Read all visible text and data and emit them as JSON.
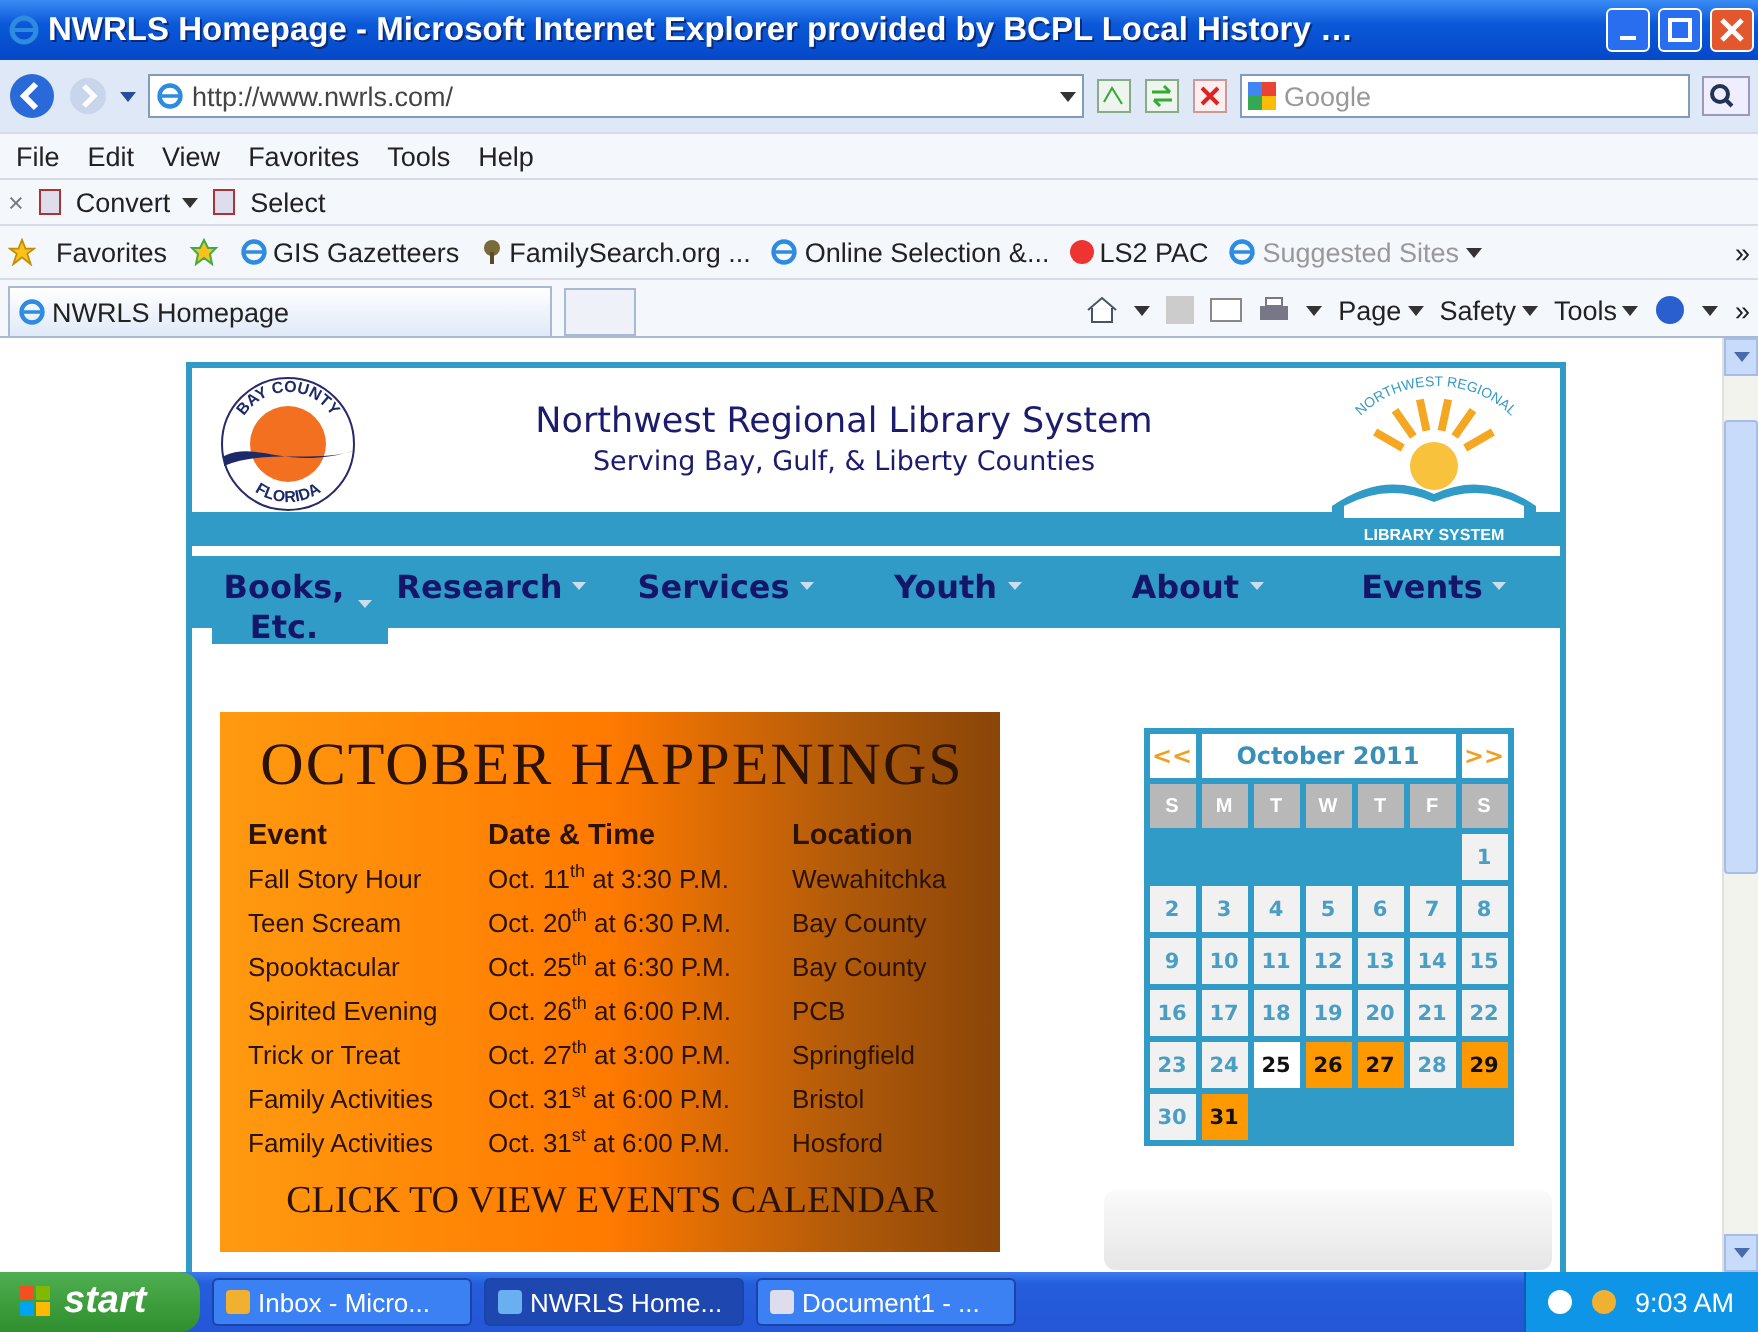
{
  "window": {
    "title": "NWRLS Homepage - Microsoft Internet Explorer provided by BCPL Local History …"
  },
  "address_bar": {
    "value": "http://www.nwrls.com/"
  },
  "search": {
    "placeholder": "Google"
  },
  "menu": [
    "File",
    "Edit",
    "View",
    "Favorites",
    "Tools",
    "Help"
  ],
  "addon_bar": {
    "close": "×",
    "items": [
      "Convert",
      "Select"
    ]
  },
  "favorites_bar": {
    "label": "Favorites",
    "items": [
      "GIS Gazetteers",
      "FamilySearch.org ...",
      "Online Selection &...",
      "LS2 PAC",
      "Suggested Sites"
    ],
    "more": "»"
  },
  "tabs": [
    {
      "label": "NWRLS Homepage",
      "selected": true
    }
  ],
  "command_bar": {
    "items": [
      "Page",
      "Safety",
      "Tools"
    ],
    "more": "»"
  },
  "site": {
    "title": "Northwest Regional Library System",
    "subtitle": "Serving Bay, Gulf, & Liberty Counties",
    "seal": {
      "top": "BAY COUNTY",
      "bottom": "FLORIDA"
    },
    "logo": {
      "arc": "NORTHWEST REGIONAL",
      "caption": "LIBRARY SYSTEM"
    },
    "nav": [
      {
        "label": "Books, Etc.",
        "selected": true
      },
      {
        "label": "Research",
        "selected": false
      },
      {
        "label": "Services",
        "selected": false
      },
      {
        "label": "Youth",
        "selected": false
      },
      {
        "label": "About",
        "selected": false
      },
      {
        "label": "Events",
        "selected": false
      }
    ]
  },
  "poster": {
    "title": "OCTOBER HAPPENINGS",
    "columns": [
      "Event",
      "Date & Time",
      "Location"
    ],
    "rows": [
      [
        "Fall Story Hour",
        "Oct. 11$^{th}$ at 3:30 P.M.",
        "Wewahitchka"
      ],
      [
        "Teen Scream",
        "Oct. 20$^{th}$ at 6:30 P.M.",
        "Bay County"
      ],
      [
        "Spooktacular",
        "Oct. 25$^{th}$ at 6:30 P.M.",
        "Bay County"
      ],
      [
        "Spirited Evening",
        "Oct. 26$^{th}$ at 6:00 P.M.",
        "PCB"
      ],
      [
        "Trick or Treat",
        "Oct. 27$^{th}$ at 3:00 P.M.",
        "Springfield"
      ],
      [
        "Family Activities",
        "Oct. 31$^{st}$ at 6:00 P.M.",
        "Bristol"
      ],
      [
        "Family Activities",
        "Oct. 31$^{st}$ at 6:00 P.M.",
        "Hosford"
      ]
    ],
    "link": "CLICK TO VIEW EVENTS CALENDAR"
  },
  "calendar": {
    "prev": "<<",
    "month": "October 2011",
    "next": ">>",
    "weekdays": [
      "S",
      "M",
      "T",
      "W",
      "T",
      "F",
      "S"
    ],
    "weeks": [
      [
        {
          "day": "1",
          "kind": "normal"
        }
      ],
      [
        {
          "day": "2",
          "kind": "normal"
        },
        {
          "day": "3",
          "kind": "normal"
        },
        {
          "day": "4",
          "kind": "normal"
        },
        {
          "day": "5",
          "kind": "normal"
        },
        {
          "day": "6",
          "kind": "normal"
        },
        {
          "day": "7",
          "kind": "normal"
        },
        {
          "day": "8",
          "kind": "normal"
        }
      ],
      [
        {
          "day": "9",
          "kind": "normal"
        },
        {
          "day": "10",
          "kind": "normal"
        },
        {
          "day": "11",
          "kind": "normal"
        },
        {
          "day": "12",
          "kind": "normal"
        },
        {
          "day": "13",
          "kind": "normal"
        },
        {
          "day": "14",
          "kind": "normal"
        },
        {
          "day": "15",
          "kind": "normal"
        }
      ],
      [
        {
          "day": "16",
          "kind": "normal"
        },
        {
          "day": "17",
          "kind": "normal"
        },
        {
          "day": "18",
          "kind": "normal"
        },
        {
          "day": "19",
          "kind": "normal"
        },
        {
          "day": "20",
          "kind": "normal"
        },
        {
          "day": "21",
          "kind": "normal"
        },
        {
          "day": "22",
          "kind": "normal"
        }
      ],
      [
        {
          "day": "23",
          "kind": "normal"
        },
        {
          "day": "24",
          "kind": "normal"
        },
        {
          "day": "25",
          "kind": "today"
        },
        {
          "day": "26",
          "kind": "event"
        },
        {
          "day": "27",
          "kind": "event"
        },
        {
          "day": "28",
          "kind": "normal"
        },
        {
          "day": "29",
          "kind": "event"
        }
      ],
      [
        {
          "day": "30",
          "kind": "normal"
        },
        {
          "day": "31",
          "kind": "event"
        }
      ]
    ]
  },
  "taskbar": {
    "start": "start",
    "tasks": [
      {
        "label": "Inbox - Micro...",
        "selected": false
      },
      {
        "label": "NWRLS Home...",
        "selected": true
      },
      {
        "label": "Document1 - ...",
        "selected": false
      }
    ],
    "clock": "9:03 AM"
  }
}
